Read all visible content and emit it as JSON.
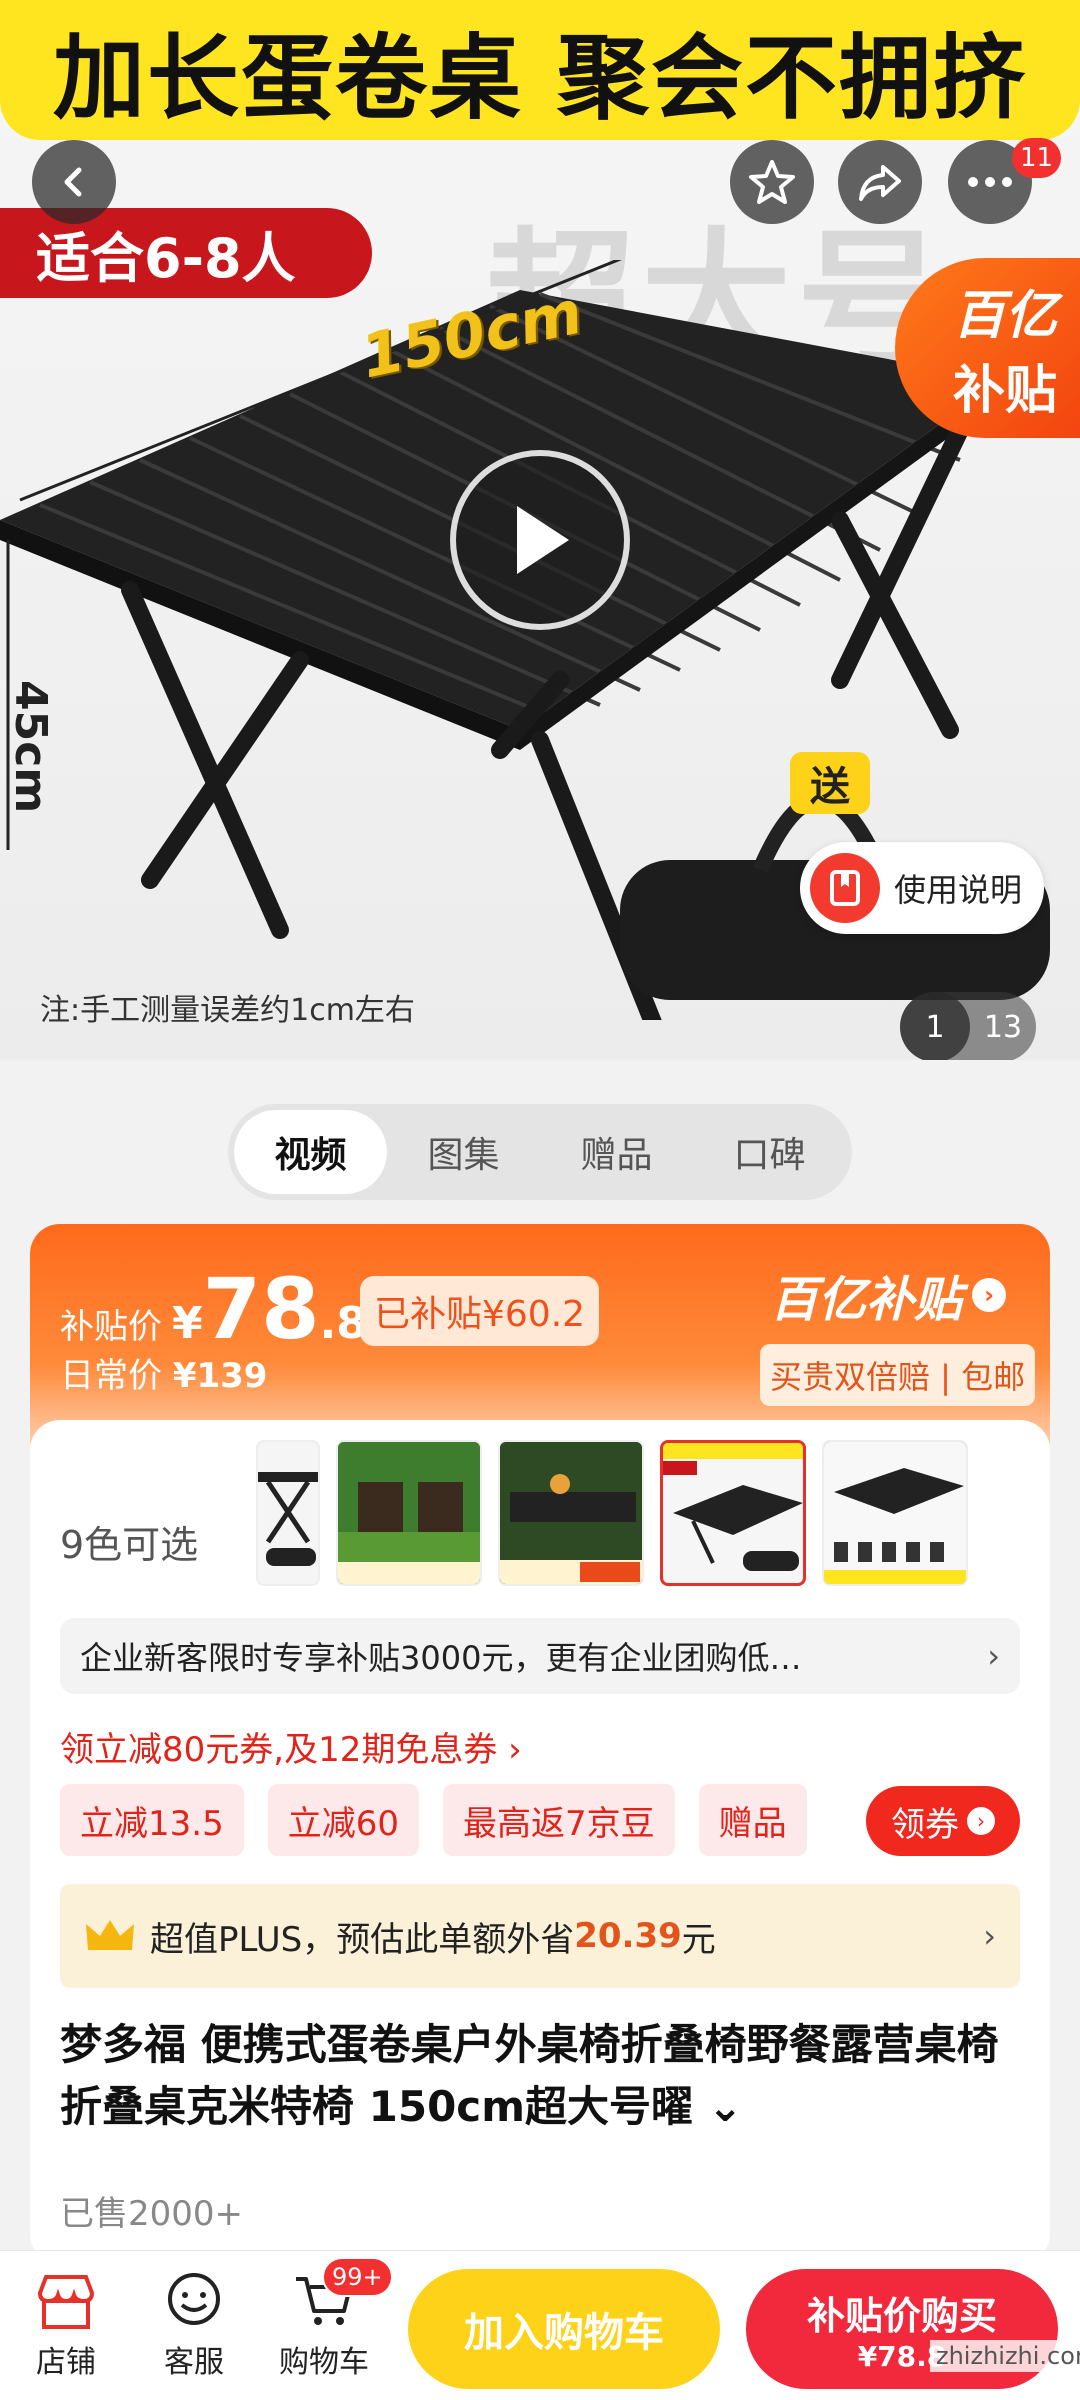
{
  "hero": {
    "banner_text": "加长蛋卷桌 聚会不拥挤",
    "watermark_text": "超大号",
    "people_tag": "适合6-8人",
    "subsidy_corner": {
      "line1": "百亿",
      "line2": "补贴"
    },
    "dimension_length": "150cm",
    "dimension_height": "45cm",
    "gift_tag": "送",
    "note": "注:手工测量误差约1cm左右",
    "manual_label": "使用说明",
    "page_current": "1",
    "page_total": "13",
    "message_badge": "11",
    "icons": {
      "back": "chevron-left-icon",
      "favorite": "star-icon",
      "share": "share-icon",
      "more": "more-icon",
      "play": "play-icon",
      "manual": "book-icon"
    }
  },
  "media_tabs": [
    {
      "label": "视频",
      "active": true
    },
    {
      "label": "图集",
      "active": false
    },
    {
      "label": "赠品",
      "active": false
    },
    {
      "label": "口碑",
      "active": false
    }
  ],
  "price": {
    "label": "补贴价",
    "currency": "¥",
    "integer": "78",
    "decimal": ".8",
    "subsidized": "已补贴¥60.2",
    "regular_label": "日常价",
    "regular_value": "¥139",
    "brand": "百亿补贴",
    "guarantee": "买贵双倍赔 | 包邮"
  },
  "colors": {
    "label": "9色可选"
  },
  "enterprise": {
    "text": "企业新客限时专享补贴3000元，更有企业团购低…",
    "chevron": "›"
  },
  "coupon": {
    "line": "领立减80元券,及12期免息券 ›",
    "chips": [
      "立减13.5",
      "立减60",
      "最高返7京豆",
      "赠品"
    ],
    "get_button": "领券"
  },
  "plus": {
    "prefix": "超值PLUS，预估此单额外省",
    "amount": "20.39",
    "suffix": "元",
    "chevron": "›"
  },
  "product": {
    "title": "梦多福 便携式蛋卷桌户外桌椅折叠椅野餐露营桌椅折叠桌克米特椅 150cm超大号曜 ⌄",
    "sold": "已售2000+"
  },
  "bottom_bar": {
    "store": "店铺",
    "service": "客服",
    "cart": "购物车",
    "cart_badge": "99+",
    "add_to_cart": "加入购物车",
    "buy_title": "补贴价购买",
    "buy_price": "¥78.8"
  },
  "site_watermark": "zhizhizhi.com",
  "colors_theme": {
    "accent_red": "#f2283c",
    "accent_orange": "#ff6a1c",
    "accent_yellow": "#ffd21a"
  }
}
